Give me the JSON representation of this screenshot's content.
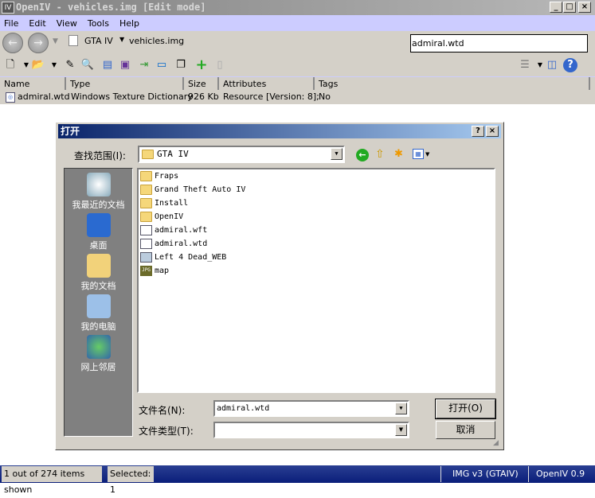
{
  "window": {
    "title": "OpenIV - vehicles.img [Edit mode]",
    "app_icon": "IV",
    "minimize": "_",
    "maximize": "□",
    "close": "×"
  },
  "menu": [
    "File",
    "Edit",
    "View",
    "Tools",
    "Help"
  ],
  "nav": {
    "back_icon": "back-arrow-icon",
    "forward_icon": "forward-arrow-icon",
    "breadcrumb": [
      "GTA IV",
      "vehicles.img"
    ],
    "search_value": "admiral.wtd"
  },
  "columns": [
    "Name",
    "Type",
    "Size",
    "Attributes",
    "Tags"
  ],
  "rows": [
    {
      "name": "admiral.wtd",
      "type": "Windows Texture Dictionary",
      "size": "926 Kb",
      "attributes": "Resource [Version: 8];",
      "tags": "No"
    }
  ],
  "status": {
    "shown": "1 out of 274 items shown",
    "selected": "Selected: 1",
    "format": "IMG v3 (GTAIV)",
    "version": "OpenIV 0.9"
  },
  "dialog": {
    "title": "打开",
    "help": "?",
    "close": "×",
    "look_in_label": "查找范围(I):",
    "look_in_value": "GTA IV",
    "places": [
      "我最近的文档",
      "桌面",
      "我的文档",
      "我的电脑",
      "网上邻居"
    ],
    "files": [
      {
        "name": "Fraps",
        "kind": "folder"
      },
      {
        "name": "Grand Theft Auto IV",
        "kind": "folder"
      },
      {
        "name": "Install",
        "kind": "folder"
      },
      {
        "name": "OpenIV",
        "kind": "folder"
      },
      {
        "name": "admiral.wft",
        "kind": "file"
      },
      {
        "name": "admiral.wtd",
        "kind": "file"
      },
      {
        "name": "Left 4 Dead_WEB",
        "kind": "video"
      },
      {
        "name": "map",
        "kind": "jpg",
        "badge": "JPG"
      }
    ],
    "filename_label": "文件名(N):",
    "filename_value": "admiral.wtd",
    "filetype_label": "文件类型(T):",
    "filetype_value": "",
    "open_button": "打开(O)",
    "cancel_button": "取消"
  }
}
